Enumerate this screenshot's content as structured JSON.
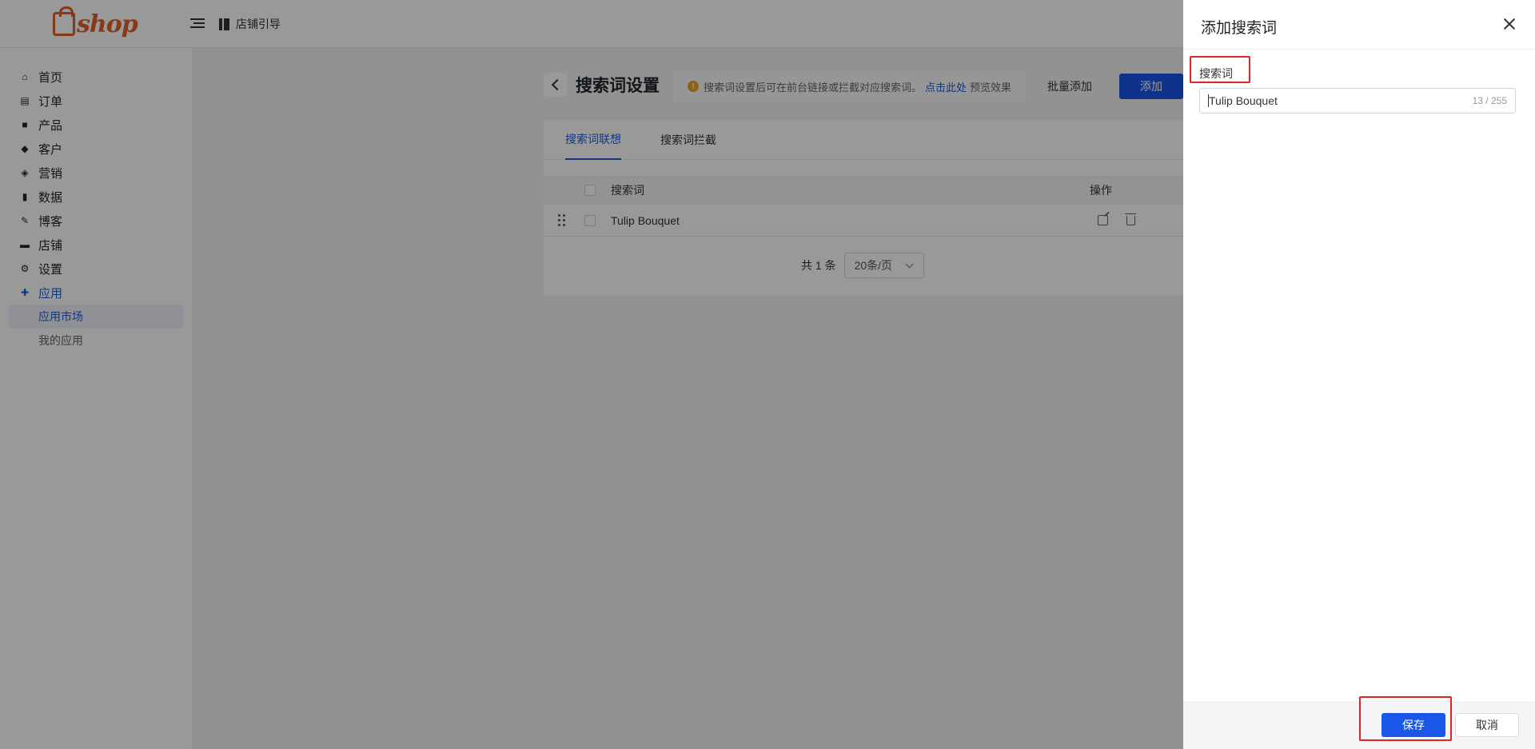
{
  "header": {
    "logo_text": "shop",
    "guide_label": "店铺引导"
  },
  "sidebar": {
    "items": [
      {
        "label": "首页",
        "icon": "home-icon"
      },
      {
        "label": "订单",
        "icon": "clipboard-icon"
      },
      {
        "label": "产品",
        "icon": "bag-icon"
      },
      {
        "label": "客户",
        "icon": "diamond-icon"
      },
      {
        "label": "营销",
        "icon": "tag-icon"
      },
      {
        "label": "数据",
        "icon": "bar-chart-icon"
      },
      {
        "label": "博客",
        "icon": "edit-icon"
      },
      {
        "label": "店铺",
        "icon": "store-icon"
      },
      {
        "label": "设置",
        "icon": "gear-icon"
      },
      {
        "label": "应用",
        "icon": "puzzle-icon"
      }
    ],
    "sub_items": [
      {
        "label": "应用市场"
      },
      {
        "label": "我的应用"
      }
    ]
  },
  "main": {
    "title": "搜索词设置",
    "notice_text": "搜索词设置后可在前台链接或拦截对应搜索词。",
    "notice_link": "点击此处",
    "notice_suffix": "预览效果",
    "batch_add_label": "批量添加",
    "add_label": "添加",
    "tabs": [
      {
        "label": "搜索词联想"
      },
      {
        "label": "搜索词拦截"
      }
    ],
    "table": {
      "columns": [
        "搜索词",
        "操作"
      ],
      "rows": [
        {
          "term": "Tulip Bouquet"
        }
      ]
    },
    "pager": {
      "total_text": "共 1 条",
      "page_size": "20条/页"
    }
  },
  "drawer": {
    "title": "添加搜索词",
    "field_label": "搜索词",
    "field_value": "Tulip Bouquet",
    "counter": "13 / 255",
    "save_label": "保存",
    "cancel_label": "取消"
  },
  "colors": {
    "accent": "#1a56e8",
    "brand": "#e2622c",
    "highlight_box": "#e02424"
  }
}
